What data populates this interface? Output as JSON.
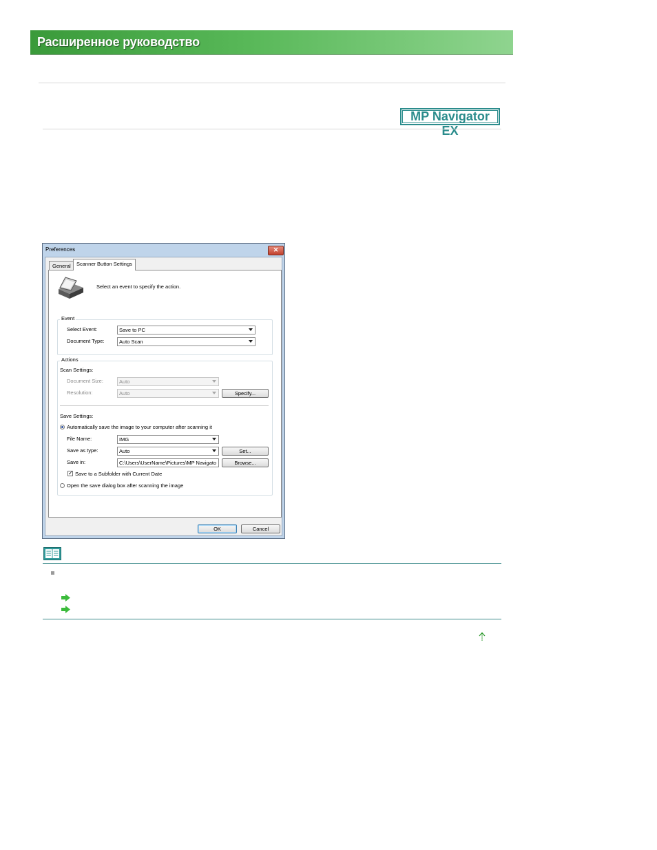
{
  "header": {
    "title": "Расширенное руководство"
  },
  "brand": {
    "label": "MP Navigator EX"
  },
  "dialog": {
    "title": "Preferences",
    "close_glyph": "✕",
    "tabs": [
      {
        "label": "General"
      },
      {
        "label": "Scanner Button Settings"
      }
    ],
    "intro": "Select an event to specify the action.",
    "event": {
      "group_label": "Event",
      "select_event_label": "Select Event:",
      "select_event_value": "Save to PC",
      "document_type_label": "Document Type:",
      "document_type_value": "Auto Scan"
    },
    "actions": {
      "group_label": "Actions",
      "scan_settings_label": "Scan Settings:",
      "document_size_label": "Document Size:",
      "document_size_value": "Auto",
      "resolution_label": "Resolution:",
      "resolution_value": "Auto",
      "specify_button": "Specify...",
      "save_settings_label": "Save Settings:",
      "auto_save_radio": "Automatically save the image to your computer after scanning it",
      "file_name_label": "File Name:",
      "file_name_value": "IMG",
      "save_as_type_label": "Save as type:",
      "save_as_type_value": "Auto",
      "set_button": "Set...",
      "save_in_label": "Save in:",
      "save_in_value": "C:\\Users\\UserName\\Pictures\\MP Navigato",
      "browse_button": "Browse...",
      "subfolder_checkbox": "Save to a Subfolder with Current Date",
      "open_dialog_radio": "Open the save dialog box after scanning the image"
    },
    "ok_button": "OK",
    "cancel_button": "Cancel"
  },
  "colors": {
    "banner": "#58b858",
    "brand": "#2b8c8c",
    "rule": "#3a8a8a",
    "link_arrow": "#3bbb3b"
  },
  "icons": [
    "note-book-icon",
    "scanner-icon",
    "right-arrow-icon",
    "up-arrow-icon"
  ]
}
